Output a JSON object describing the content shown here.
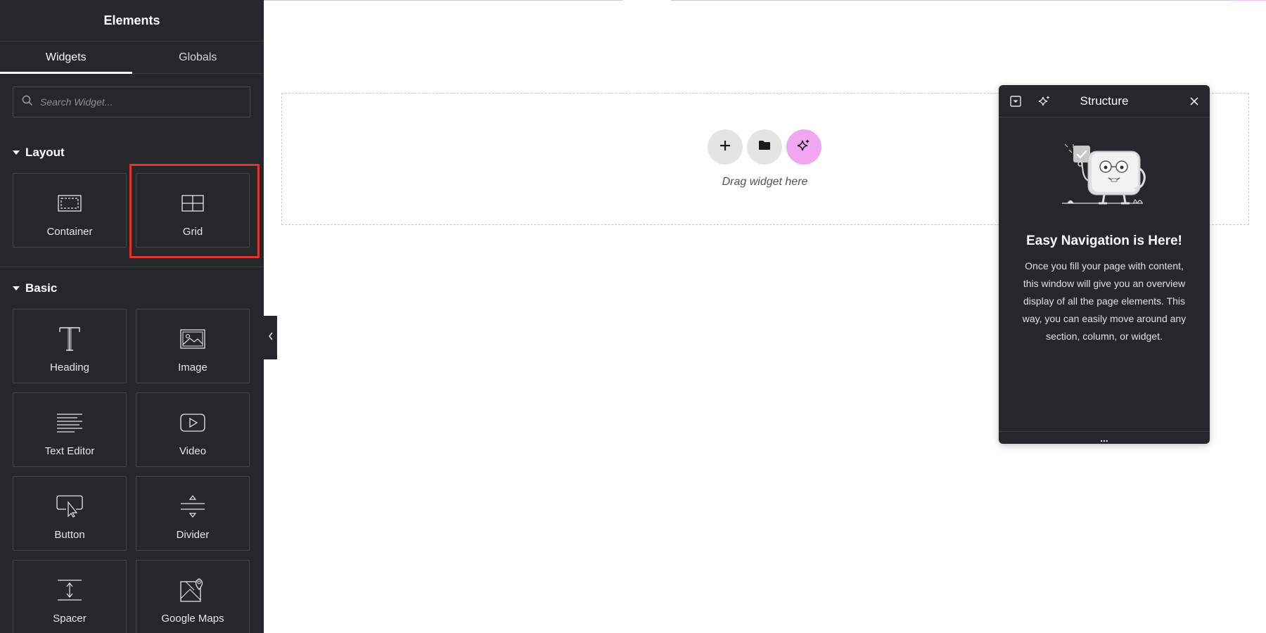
{
  "sidebar": {
    "title": "Elements",
    "tabs": [
      {
        "label": "Widgets",
        "active": true
      },
      {
        "label": "Globals",
        "active": false
      }
    ],
    "search": {
      "placeholder": "Search Widget...",
      "value": ""
    },
    "sections": [
      {
        "title": "Layout",
        "widgets": [
          {
            "label": "Container",
            "icon": "container-icon"
          },
          {
            "label": "Grid",
            "icon": "grid-icon",
            "highlighted": true
          }
        ]
      },
      {
        "title": "Basic",
        "widgets": [
          {
            "label": "Heading",
            "icon": "heading-icon"
          },
          {
            "label": "Image",
            "icon": "image-icon"
          },
          {
            "label": "Text Editor",
            "icon": "text-editor-icon"
          },
          {
            "label": "Video",
            "icon": "video-icon"
          },
          {
            "label": "Button",
            "icon": "button-icon"
          },
          {
            "label": "Divider",
            "icon": "divider-icon"
          },
          {
            "label": "Spacer",
            "icon": "spacer-icon"
          },
          {
            "label": "Google Maps",
            "icon": "google-maps-icon"
          }
        ]
      }
    ]
  },
  "canvas": {
    "drop_text": "Drag widget here",
    "buttons": [
      {
        "name": "add-section",
        "icon": "plus-icon"
      },
      {
        "name": "template-library",
        "icon": "folder-icon"
      },
      {
        "name": "ai-assistant",
        "icon": "sparkle-icon"
      }
    ]
  },
  "structure": {
    "title": "Structure",
    "heading": "Easy Navigation is Here!",
    "description": "Once you fill your page with content, this window will give you an overview display of all the page elements. This way, you can easily move around any section, column, or widget.",
    "footer": "..."
  },
  "colors": {
    "panel_bg": "#26272b",
    "highlight": "#e0342c",
    "ai_button_bg": "#f0a6f0",
    "neutral_button_bg": "#e4e4e4"
  }
}
